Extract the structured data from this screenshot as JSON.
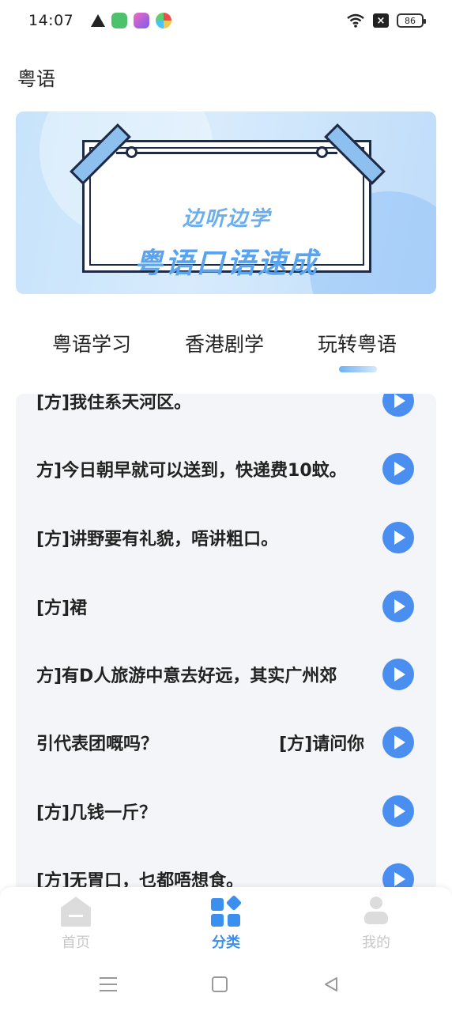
{
  "status_bar": {
    "time": "14:07",
    "battery": "86"
  },
  "page": {
    "title": "粤语"
  },
  "banner": {
    "line1": "边听边学",
    "line2": "粤语口语速成"
  },
  "tabs": [
    {
      "label": "粤语学习"
    },
    {
      "label": "香港剧学"
    },
    {
      "label": "玩转粤语",
      "active": true
    }
  ],
  "list": [
    {
      "text": "[方]我住系天河区。"
    },
    {
      "text": "方]今日朝早就可以送到，快递费10蚊。"
    },
    {
      "text": "[方]讲野要有礼貌，唔讲粗口。"
    },
    {
      "text": "[方]裙"
    },
    {
      "text": "方]有D人旅游中意去好远，其实广州郊"
    },
    {
      "text": "引代表团嘅吗？                    [方]请问你"
    },
    {
      "text": "[方]几钱一斤？"
    },
    {
      "text": "[方]无胃口，乜都唔想食。"
    }
  ],
  "bottom_nav": {
    "items": [
      {
        "label": "首页",
        "icon": "home-icon",
        "active": false
      },
      {
        "label": "分类",
        "icon": "category-icon",
        "active": true
      },
      {
        "label": "我的",
        "icon": "profile-icon",
        "active": false
      }
    ]
  },
  "colors": {
    "accent": "#3a8fef",
    "play_button": "#4a8ff0",
    "banner_text": "#5aa3ee"
  }
}
